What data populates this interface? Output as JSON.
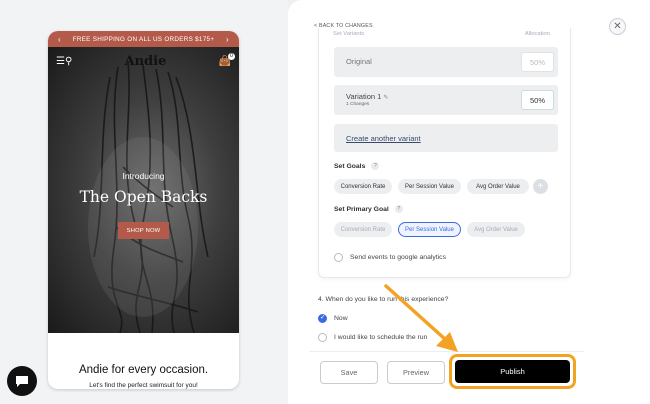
{
  "storefront": {
    "promo_text": "FREE SHIPPING ON ALL US ORDERS $175+",
    "brand": "Andie",
    "cart_count": "0",
    "intro": "Introducing",
    "headline": "The Open Backs",
    "cta": "SHOP NOW",
    "section_title": "Andie for every occasion.",
    "section_sub": "Let's find the perfect swimsuit for you!"
  },
  "panel": {
    "back_link": "< BACK TO CHANGES",
    "col_variants": "Set Variants",
    "col_allocation": "Allocation",
    "variants": [
      {
        "name": "Original",
        "pct": "50%"
      },
      {
        "name": "Variation 1",
        "sub": "1 Changes",
        "pct": "50%"
      }
    ],
    "create_variant": "Create another variant",
    "goals_title": "Set Goals",
    "goals": [
      "Conversion Rate",
      "Per Session Value",
      "Avg Order Value"
    ],
    "primary_title": "Set Primary Goal",
    "primary_goals": [
      "Conversion Rate",
      "Per Session Value",
      "Avg Order Value"
    ],
    "primary_selected": "Per Session Value",
    "ga_option": "Send events to google analytics",
    "question": "4. When do you like to run this experience?",
    "run_now": "Now",
    "run_schedule": "I would like to schedule the run",
    "save": "Save",
    "preview": "Preview",
    "publish": "Publish"
  },
  "colors": {
    "accent": "#3c6be0",
    "brand": "#b35a4b",
    "highlight": "#f2a323"
  },
  "icons": [
    "menu-search-icon",
    "basket-icon",
    "pencil-icon",
    "help-icon",
    "plus-icon",
    "close-icon",
    "chat-icon"
  ]
}
